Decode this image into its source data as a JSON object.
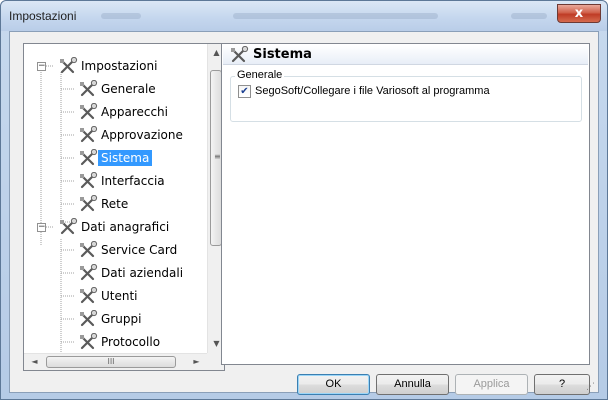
{
  "window": {
    "title": "Impostazioni",
    "close_label": "x"
  },
  "tree": {
    "items": [
      {
        "label": "Impostazioni",
        "expander": "−"
      },
      {
        "label": "Generale"
      },
      {
        "label": "Apparecchi"
      },
      {
        "label": "Approvazione"
      },
      {
        "label": "Sistema",
        "selected": true
      },
      {
        "label": "Interfaccia"
      },
      {
        "label": "Rete"
      },
      {
        "label": "Dati anagrafici",
        "expander": "−"
      },
      {
        "label": "Service Card"
      },
      {
        "label": "Dati aziendali"
      },
      {
        "label": "Utenti"
      },
      {
        "label": "Gruppi"
      },
      {
        "label": "Protocollo"
      }
    ],
    "scroll_up": "▲",
    "scroll_down": "▼",
    "scroll_left": "◄",
    "scroll_right": "►",
    "grip": "≡",
    "h_grip": "III"
  },
  "panel": {
    "title": "Sistema",
    "icon": "tools-icon",
    "group_label": "Generale",
    "checkbox_label": "SegoSoft/Collegare i file Variosoft al programma",
    "checkbox_checked": true,
    "check_mark": "✔"
  },
  "buttons": {
    "ok": "OK",
    "annulla": "Annulla",
    "applica": "Applica",
    "help": "?"
  },
  "colors": {
    "selection": "#3399ff",
    "titlebar": "#c5d7ee",
    "close": "#c94a32"
  }
}
